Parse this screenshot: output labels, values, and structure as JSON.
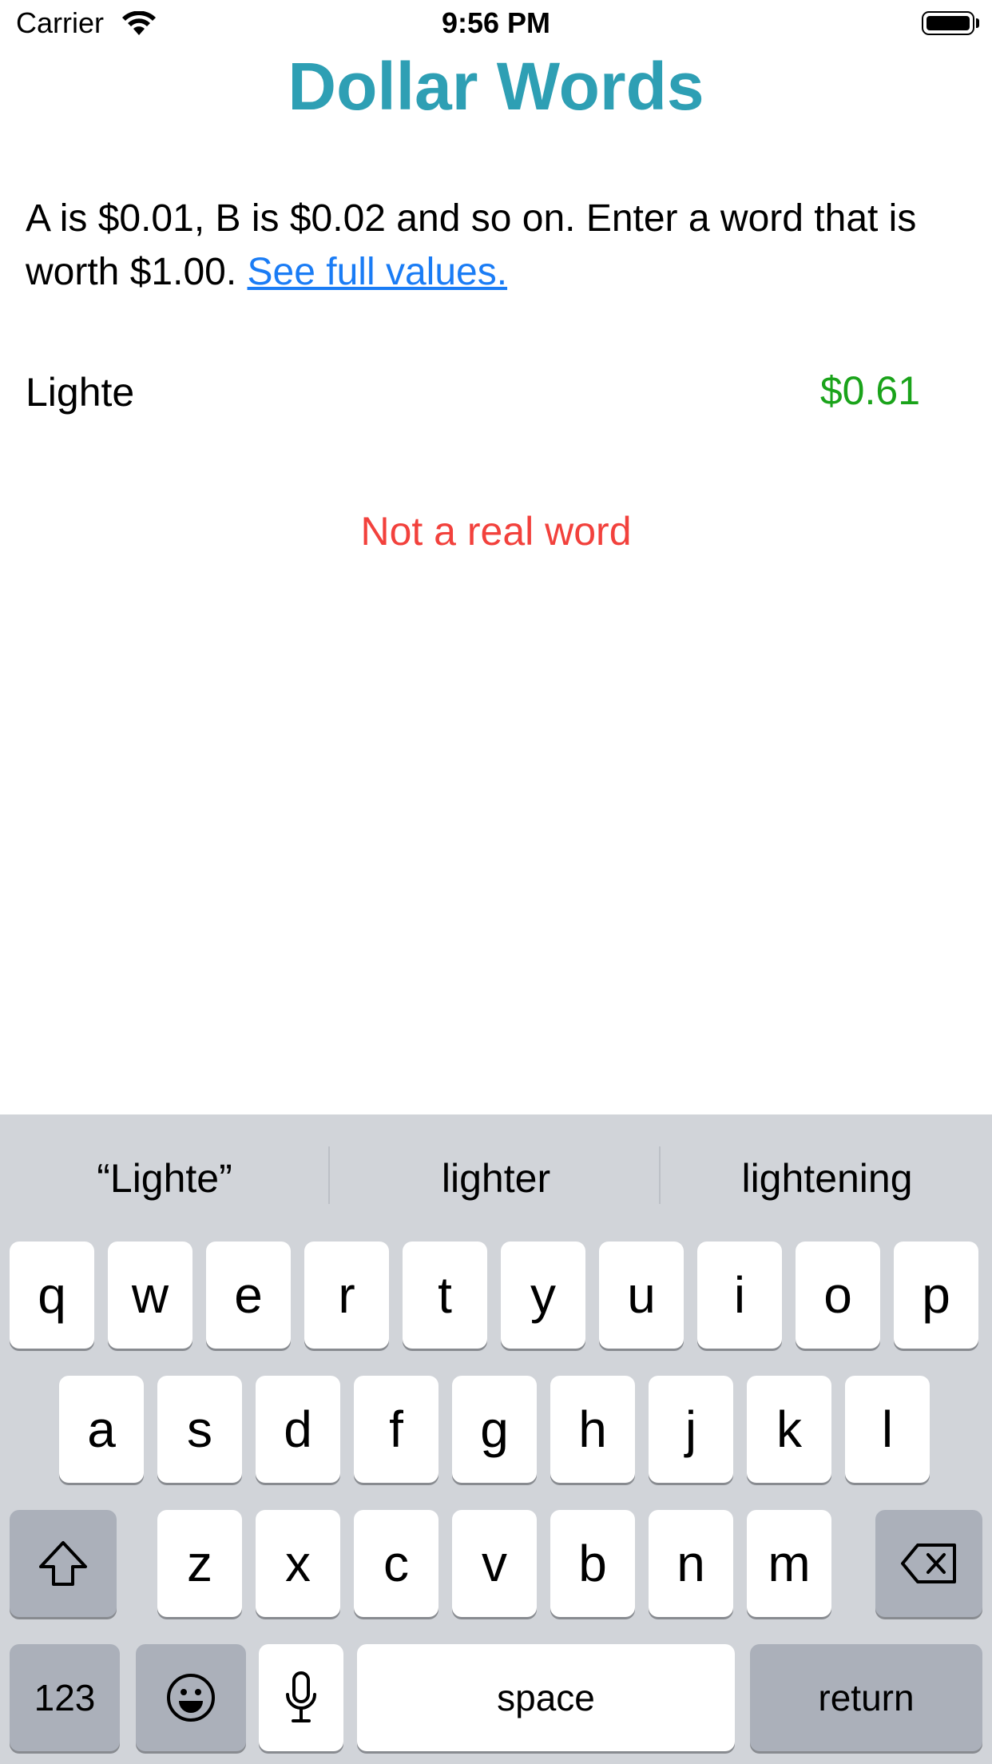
{
  "status_bar": {
    "carrier": "Carrier",
    "time": "9:56 PM"
  },
  "app": {
    "title": "Dollar Words",
    "title_color": "#2e9fb4",
    "instructions": "A is $0.01, B is $0.02 and so on. Enter a word that is worth $1.00.",
    "link_text": "See full values.",
    "link_color": "#1a7cf5",
    "word_value": "Lighte",
    "price": "$0.61",
    "price_color": "#1aa31a",
    "message": "Not a real word",
    "message_color": "#f2413c"
  },
  "keyboard": {
    "suggestions": [
      "“Lighte”",
      "lighter",
      "lightening"
    ],
    "row1": [
      "q",
      "w",
      "e",
      "r",
      "t",
      "y",
      "u",
      "i",
      "o",
      "p"
    ],
    "row2": [
      "a",
      "s",
      "d",
      "f",
      "g",
      "h",
      "j",
      "k",
      "l"
    ],
    "row3": [
      "z",
      "x",
      "c",
      "v",
      "b",
      "n",
      "m"
    ],
    "numbers_label": "123",
    "space_label": "space",
    "return_label": "return",
    "icons": [
      "shift-icon",
      "delete-icon",
      "emoji-icon",
      "microphone-icon"
    ]
  }
}
